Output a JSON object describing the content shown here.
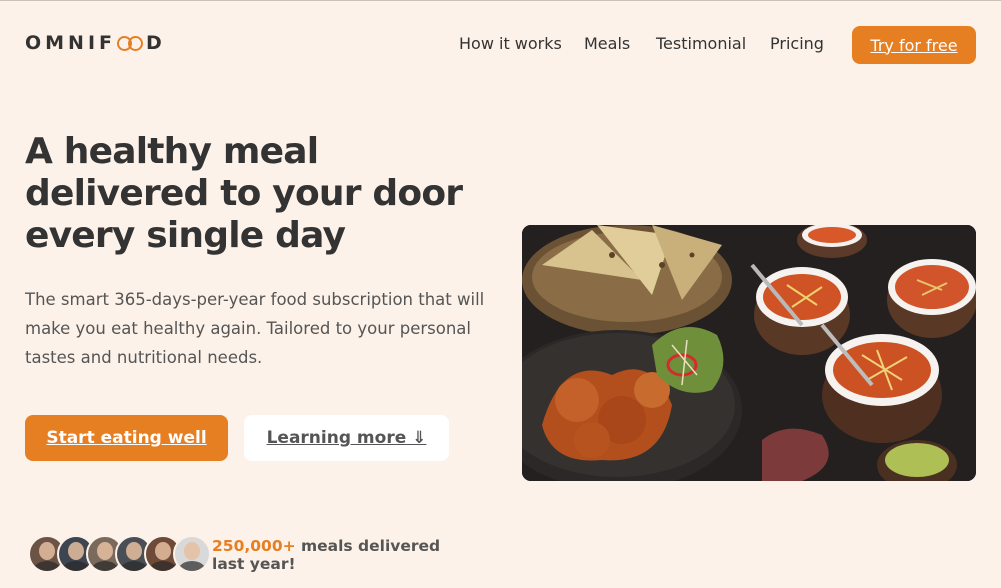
{
  "header": {
    "logo_text_start": "OMNIF",
    "logo_text_end": "D",
    "nav": [
      {
        "label": "How it works"
      },
      {
        "label": "Meals"
      },
      {
        "label": "Testimonial"
      },
      {
        "label": "Pricing"
      }
    ],
    "cta_label": "Try for free"
  },
  "hero": {
    "title": "A healthy meal delivered to your door every single day",
    "description": "The smart 365-days-per-year food subscription that will make you eat healthy again. Tailored to your personal tastes and nutritional needs.",
    "primary_button": "Start eating well",
    "secondary_button": "Learning more ⇓",
    "delivered_count": "250,000+",
    "delivered_text": " meals delivered last year!",
    "customers": [
      {
        "name": "customer-1",
        "color": "#6b5446"
      },
      {
        "name": "customer-2",
        "color": "#3d4550"
      },
      {
        "name": "customer-3",
        "color": "#7a6a5c"
      },
      {
        "name": "customer-4",
        "color": "#4a4f55"
      },
      {
        "name": "customer-5",
        "color": "#6e4a38"
      },
      {
        "name": "customer-6",
        "color": "#d9d9d9"
      }
    ]
  },
  "colors": {
    "accent": "#e67e22",
    "background": "#fdf2e9",
    "text": "#333333"
  }
}
